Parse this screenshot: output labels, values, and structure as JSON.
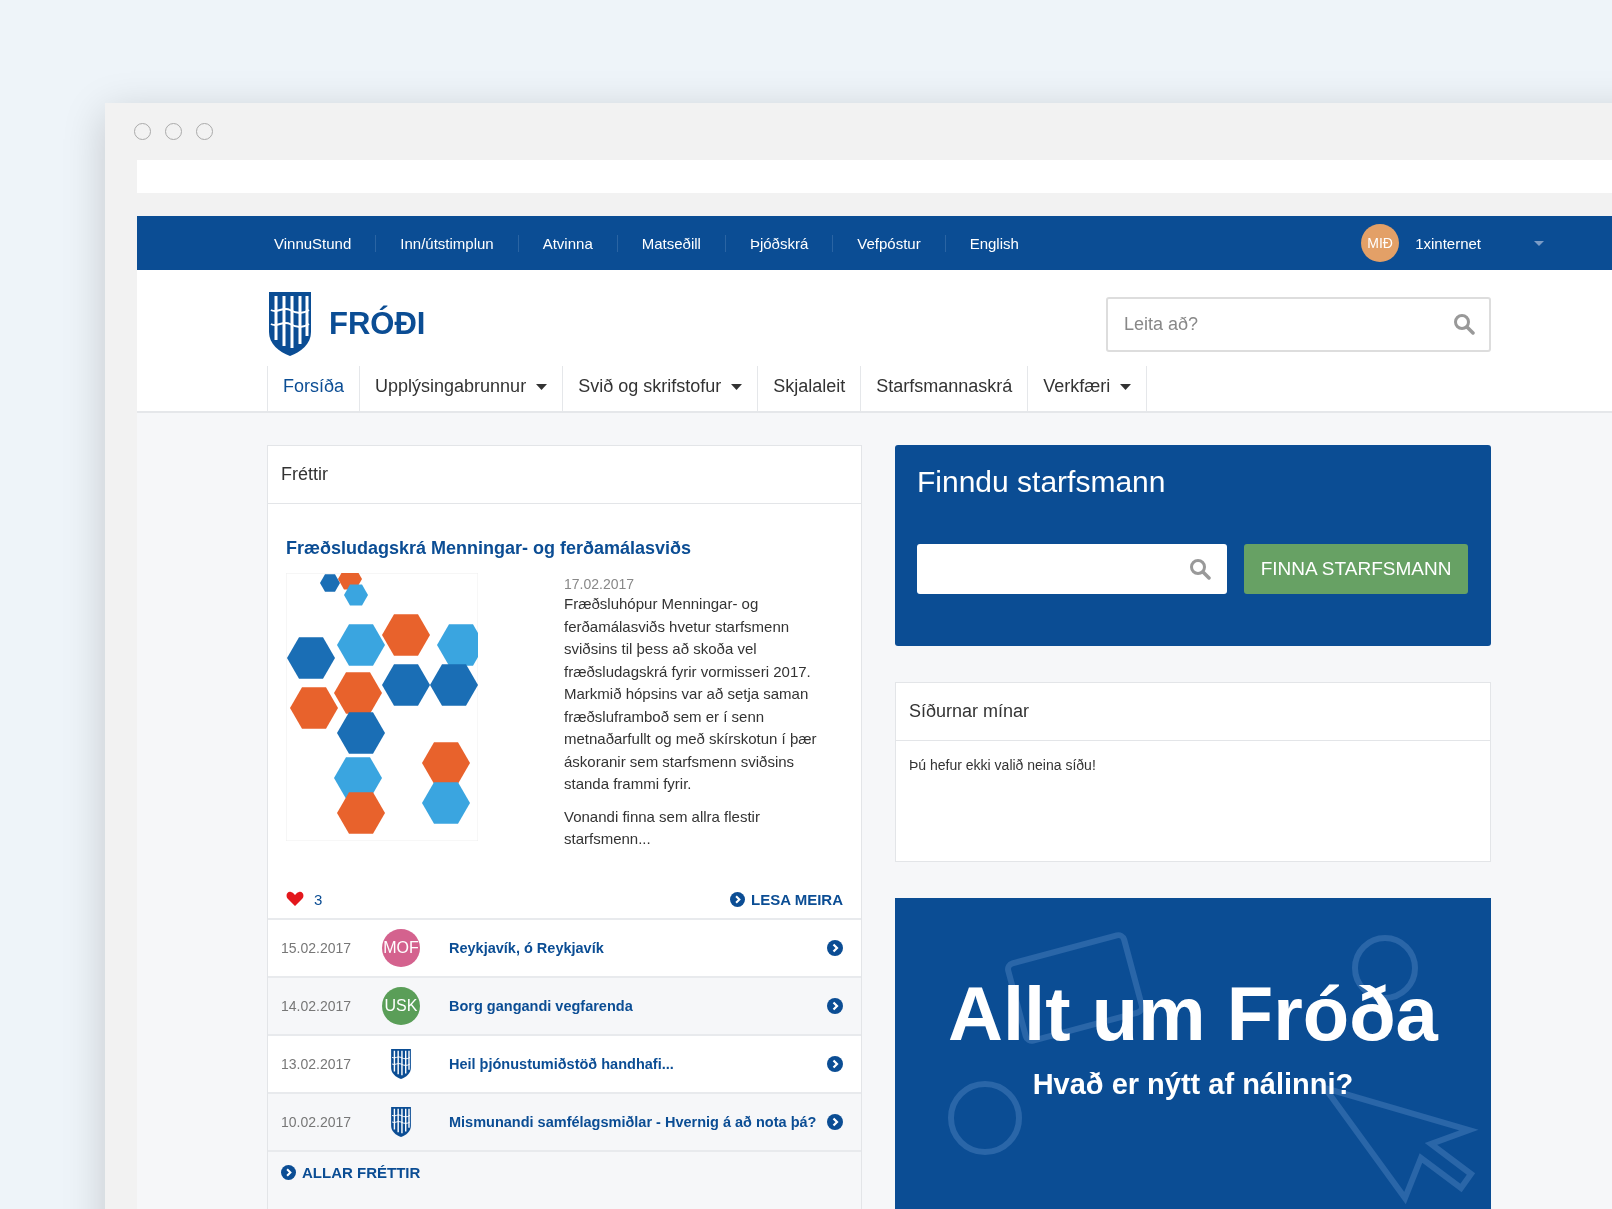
{
  "top_bar": {
    "links": [
      "VinnuStund",
      "Inn/útstimplun",
      "Atvinna",
      "Matseðill",
      "Þjóðskrá",
      "Vefpóstur",
      "English"
    ],
    "user": {
      "initials": "MIÐ",
      "name": "1xinternet"
    }
  },
  "header": {
    "logo_text": "FRÓÐI",
    "search": {
      "placeholder": "Leita að?"
    }
  },
  "main_nav": [
    {
      "label": "Forsíða",
      "selected": true,
      "dropdown": false
    },
    {
      "label": "Upplýsingabrunnur",
      "selected": false,
      "dropdown": true
    },
    {
      "label": "Svið og skrifstofur",
      "selected": false,
      "dropdown": true
    },
    {
      "label": "Skjalaleit",
      "selected": false,
      "dropdown": false
    },
    {
      "label": "Starfsmannaskrá",
      "selected": false,
      "dropdown": false
    },
    {
      "label": "Verkfæri",
      "selected": false,
      "dropdown": true
    }
  ],
  "news": {
    "title": "Fréttir",
    "featured": {
      "title": "Fræðsludagskrá Menningar- og ferðamálasviðs",
      "date": "17.02.2017",
      "paragraphs": [
        "Fræðsluhópur Menningar- og ferðamálasviðs hvetur starfsmenn sviðsins til þess að skoða vel fræðsludagskrá fyrir vormisseri 2017. Markmið hópsins var að setja saman fræðsluframboð sem er í senn metnaðarfullt og með skírskotun í þær áskoranir sem starfsmenn sviðsins standa frammi fyrir.",
        "Vonandi finna  sem allra flestir starfsmenn..."
      ],
      "likes": "3",
      "read_more": "LESA MEIRA"
    },
    "items": [
      {
        "date": "15.02.2017",
        "avatar": {
          "kind": "initials",
          "text": "MOF",
          "color": "#d4628e"
        },
        "title": "Reykjavík, ó Reykjavík"
      },
      {
        "date": "14.02.2017",
        "avatar": {
          "kind": "initials",
          "text": "USK",
          "color": "#5a9e58"
        },
        "title": "Borg gangandi vegfarenda"
      },
      {
        "date": "13.02.2017",
        "avatar": {
          "kind": "logo"
        },
        "title": "Heil þjónustumiðstöð handhafi..."
      },
      {
        "date": "10.02.2017",
        "avatar": {
          "kind": "logo"
        },
        "title": "Mismunandi samfélagsmiðlar - Hvernig á að nota þá?"
      }
    ],
    "all_link": "ALLAR FRÉTTIR"
  },
  "staff_search": {
    "title": "Finndu starfsmann",
    "button": "FINNA STARFSMANN"
  },
  "my_pages": {
    "title": "Síðurnar mínar",
    "empty_text": "Þú hefur ekki valið neina síðu!"
  },
  "banner": {
    "title": "Allt um Fróða",
    "subtitle": "Hvað er nýtt af nálinni?"
  }
}
